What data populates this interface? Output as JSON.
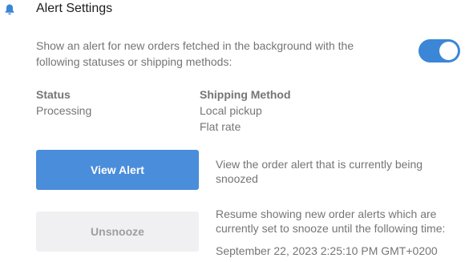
{
  "header": {
    "icon": "bell-icon",
    "title": "Alert Settings"
  },
  "alert": {
    "description": "Show an alert for new orders fetched in the background with the following statuses or shipping methods:",
    "enabled": true,
    "accent_color": "#3b86d6"
  },
  "status_column": {
    "heading": "Status",
    "items": [
      "Processing"
    ]
  },
  "shipping_column": {
    "heading": "Shipping Method",
    "items": [
      "Local pickup",
      "Flat rate"
    ]
  },
  "view_alert": {
    "label": "View Alert",
    "description": "View the order alert that is currently being snoozed",
    "color": "#4a8ddb"
  },
  "unsnooze": {
    "label": "Unsnooze",
    "description": "Resume showing new order alerts which are currently set to snooze until the following time:",
    "snooze_until": "September 22, 2023 2:25:10 PM GMT+0200",
    "disabled": true
  }
}
